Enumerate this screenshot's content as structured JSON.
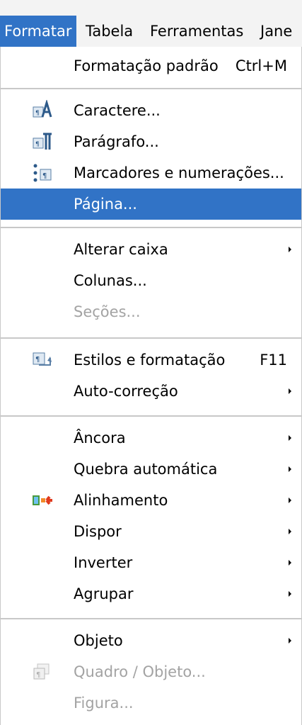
{
  "menubar": {
    "items": [
      {
        "label": "Formatar"
      },
      {
        "label": "Tabela"
      },
      {
        "label": "Ferramentas"
      },
      {
        "label": "Jane"
      }
    ]
  },
  "menu": {
    "items": [
      {
        "label": "Formatação padrão",
        "shortcut": "Ctrl+M"
      },
      {
        "label": "Caractere...",
        "icon": "character-format-icon"
      },
      {
        "label": "Parágrafo...",
        "icon": "paragraph-format-icon"
      },
      {
        "label": "Marcadores e numerações...",
        "icon": "bullets-numbering-icon"
      },
      {
        "label": "Página...",
        "state": "highlighted"
      },
      {
        "label": "Alterar caixa",
        "submenu": true
      },
      {
        "label": "Colunas..."
      },
      {
        "label": "Seções...",
        "state": "disabled"
      },
      {
        "label": "Estilos e formatação",
        "shortcut": "F11",
        "icon": "styles-formatting-icon"
      },
      {
        "label": "Auto-correção",
        "submenu": true
      },
      {
        "label": "Âncora",
        "submenu": true
      },
      {
        "label": "Quebra automática",
        "submenu": true
      },
      {
        "label": "Alinhamento",
        "submenu": true,
        "icon": "alignment-icon"
      },
      {
        "label": "Dispor",
        "submenu": true
      },
      {
        "label": "Inverter",
        "submenu": true
      },
      {
        "label": "Agrupar",
        "submenu": true
      },
      {
        "label": "Objeto",
        "submenu": true
      },
      {
        "label": "Quadro / Objeto...",
        "state": "disabled",
        "icon": "frame-object-icon"
      },
      {
        "label": "Figura...",
        "state": "disabled"
      }
    ]
  },
  "colors": {
    "highlight": "#3173c6",
    "disabled_text": "#a3a3a3",
    "separator": "#c8c8c8"
  }
}
